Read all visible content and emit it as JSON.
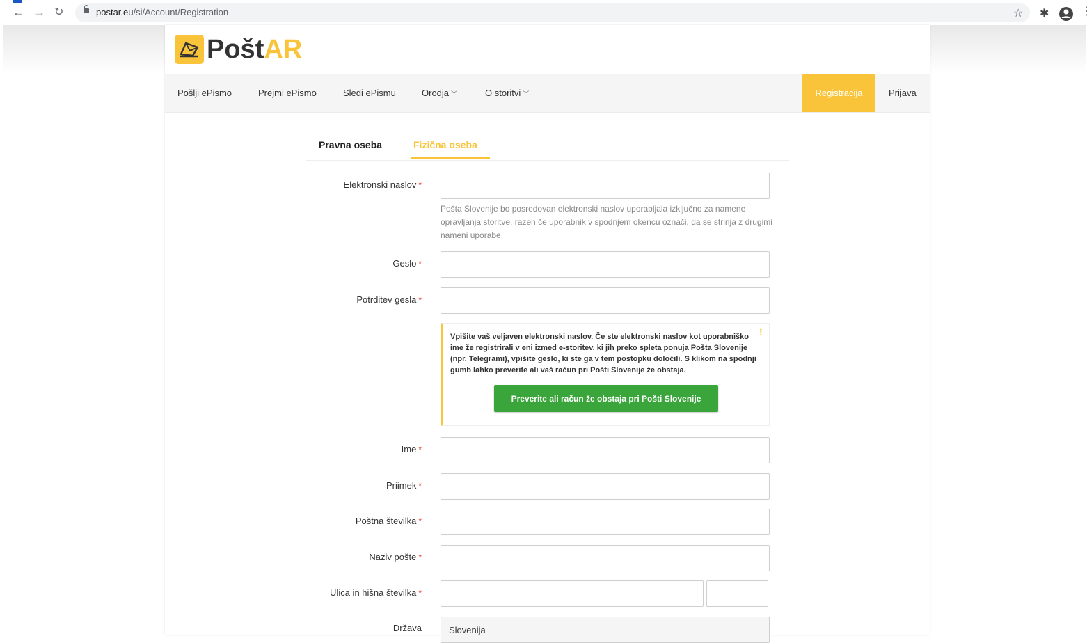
{
  "browser": {
    "url_host": "postar.eu",
    "url_path": "/si/Account/Registration"
  },
  "logo": {
    "text_main": "Pošt",
    "text_accent": "AR"
  },
  "menu": {
    "items": [
      {
        "label": "Pošlji ePismo"
      },
      {
        "label": "Prejmi ePismo"
      },
      {
        "label": "Sledi ePismu"
      },
      {
        "label": "Orodja",
        "dropdown": true
      },
      {
        "label": "O storitvi",
        "dropdown": true
      }
    ],
    "register": "Registracija",
    "login": "Prijava"
  },
  "tabs": {
    "legal": "Pravna oseba",
    "natural": "Fizična oseba",
    "active": "natural"
  },
  "form": {
    "required_mark": "*",
    "email": {
      "label": "Elektronski naslov",
      "value": ""
    },
    "email_help": "Pošta Slovenije bo posredovan elektronski naslov uporabljala izključno za namene opravljanja storitve, razen če uporabnik v spodnjem okencu označi, da se strinja z drugimi nameni uporabe.",
    "password": {
      "label": "Geslo",
      "value": ""
    },
    "password_confirm": {
      "label": "Potrditev gesla",
      "value": ""
    },
    "notice": {
      "text": "Vpišite vaš veljaven elektronski naslov. Če ste elektronski naslov kot uporabniško ime že registrirali v eni izmed e-storitev, ki jih preko spleta ponuja Pošta Slovenije (npr. Telegrami), vpišite geslo, ki ste ga v tem postopku določili. S klikom na spodnji gumb lahko preverite ali vaš račun pri Pošti Slovenije že obstaja.",
      "mark": "!",
      "button": "Preverite ali račun že obstaja pri Pošti Slovenije"
    },
    "first_name": {
      "label": "Ime",
      "value": ""
    },
    "last_name": {
      "label": "Priimek",
      "value": ""
    },
    "postal_code": {
      "label": "Poštna številka",
      "value": ""
    },
    "post_name": {
      "label": "Naziv pošte",
      "value": ""
    },
    "street": {
      "label": "Ulica in hišna številka",
      "value": "",
      "number": ""
    },
    "country": {
      "label": "Država",
      "value": "Slovenija"
    }
  },
  "colors": {
    "accent": "#f9c43a",
    "button_green": "#3aa53a",
    "required": "#e03c31"
  }
}
